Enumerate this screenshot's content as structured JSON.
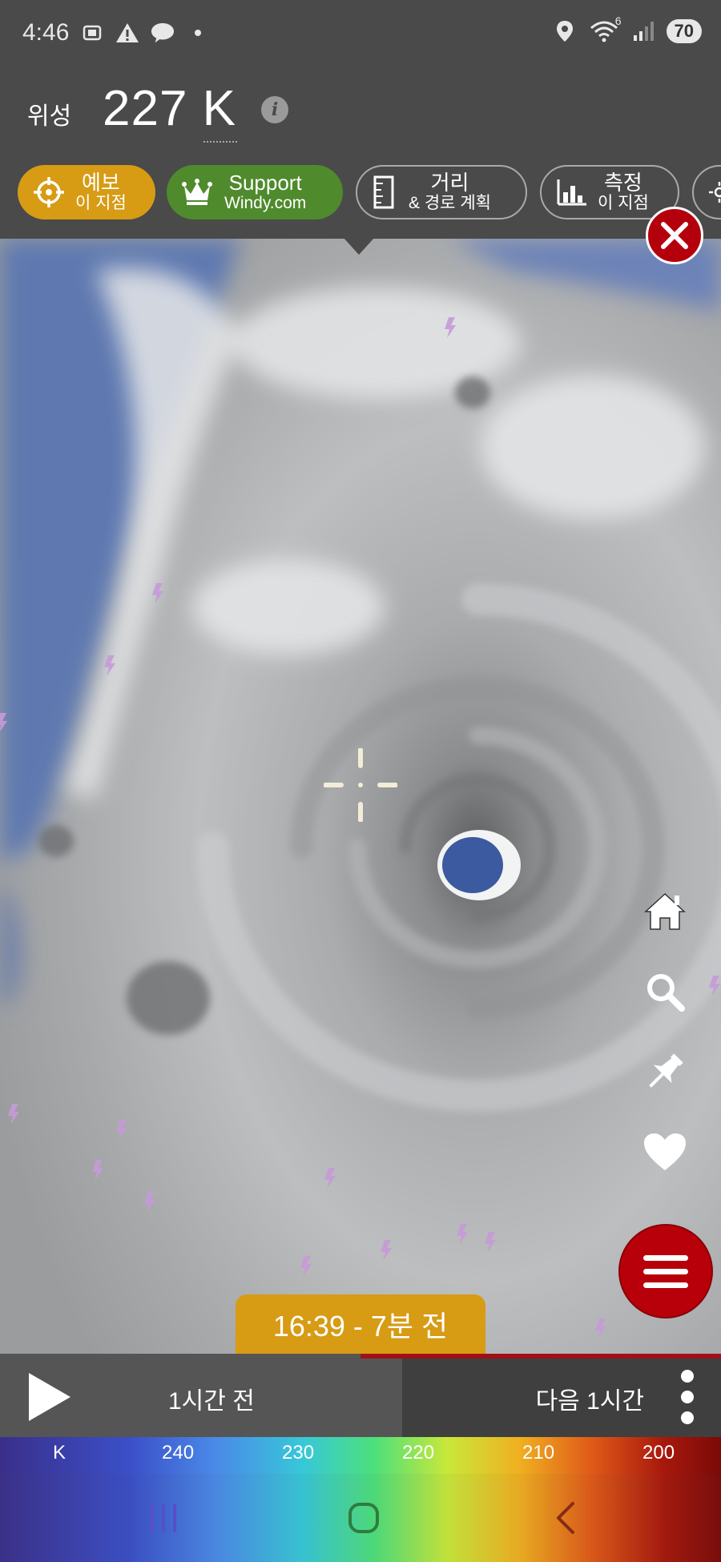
{
  "status_bar": {
    "time": "4:46",
    "network_badge": "6",
    "battery": "70",
    "icons_left": [
      "screenshot-icon",
      "alert-icon",
      "talk-icon",
      "dot-icon"
    ],
    "icons_right": [
      "location-icon",
      "wifi-icon",
      "signal-icon",
      "battery-icon"
    ]
  },
  "header": {
    "layer_label": "위성",
    "layer_value": "227 K",
    "info_glyph": "i"
  },
  "actions": [
    {
      "line1": "예보",
      "line2": "이 지점",
      "icon": "target-icon"
    },
    {
      "line1": "Support",
      "line2": "Windy.com",
      "icon": "crown-icon"
    },
    {
      "line1": "거리",
      "line2": "& 경로 계획",
      "icon": "ruler-icon"
    },
    {
      "line1": "측정",
      "line2": "이 지점",
      "icon": "chart-icon"
    }
  ],
  "map": {
    "side_tools": [
      "home-icon",
      "search-icon",
      "pin-icon",
      "heart-icon"
    ],
    "timestamp": "16:39 - 7분 전"
  },
  "timeline": {
    "prev_label": "1시간 전",
    "next_label": "다음 1시간",
    "progress": 0.5
  },
  "legend": {
    "unit": "K",
    "ticks": [
      "240",
      "230",
      "220",
      "210",
      "200"
    ]
  },
  "colors": {
    "forecast_pill": "#d79b14",
    "support_pill": "#4f8a2c",
    "close_button": "#b3000c",
    "menu_button": "#b8000a"
  }
}
